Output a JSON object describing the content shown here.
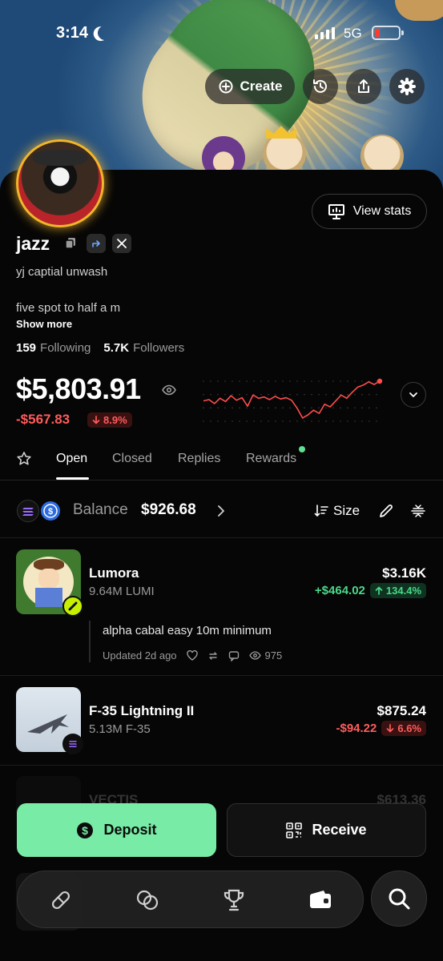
{
  "status_bar": {
    "time": "3:14",
    "network": "5G"
  },
  "header": {
    "create_label": "Create",
    "icons": [
      "history-icon",
      "share-icon",
      "settings-icon"
    ]
  },
  "profile": {
    "view_stats_label": "View stats",
    "username": "jazz",
    "bio_line1": "yj captial unwash",
    "bio_line2": "five spot to half a m",
    "show_more": "Show more",
    "following_count": "159",
    "following_label": "Following",
    "followers_count": "5.7K",
    "followers_label": "Followers"
  },
  "portfolio": {
    "total": "$5,803.91",
    "pnl": "-$567.83",
    "pnl_pct": "8.9%"
  },
  "chart_data": {
    "type": "line",
    "series": [
      {
        "values": [
          8,
          8.2,
          7.6,
          8.4,
          7.9,
          8.8,
          8.1,
          8.5,
          7.2,
          8.9,
          8.4,
          8.6,
          8.2,
          8.7,
          8.3,
          8.5,
          8.1,
          6.9,
          5.4,
          5.9,
          6.6,
          6.1,
          7.5,
          7.1,
          8.0,
          8.9,
          8.4,
          9.3,
          10.1,
          10.4,
          10.9,
          10.5,
          11.0
        ]
      }
    ],
    "color": "#ff4d4d"
  },
  "tabs": {
    "open": "Open",
    "closed": "Closed",
    "replies": "Replies",
    "rewards": "Rewards"
  },
  "balance": {
    "label": "Balance",
    "value": "$926.68",
    "size_label": "Size"
  },
  "tokens": [
    {
      "name": "Lumora",
      "sub": "9.64M LUMI",
      "value": "$3.16K",
      "change": "+$464.02",
      "change_pct": "134.4%",
      "post_text": "alpha cabal easy 10m minimum",
      "post_meta": "Updated 2d ago",
      "post_views": "975"
    },
    {
      "name": "F-35 Lightning II",
      "sub": "5.13M F-35",
      "value": "$875.24",
      "change": "-$94.22",
      "change_pct": "6.6%"
    },
    {
      "name": "VECTIS",
      "value": "$613.36"
    }
  ],
  "actions": {
    "deposit_label": "Deposit",
    "receive_label": "Receive"
  },
  "colors": {
    "accent_green": "#78eba6",
    "negative": "#ff5c5c",
    "positive": "#4ad98a"
  }
}
